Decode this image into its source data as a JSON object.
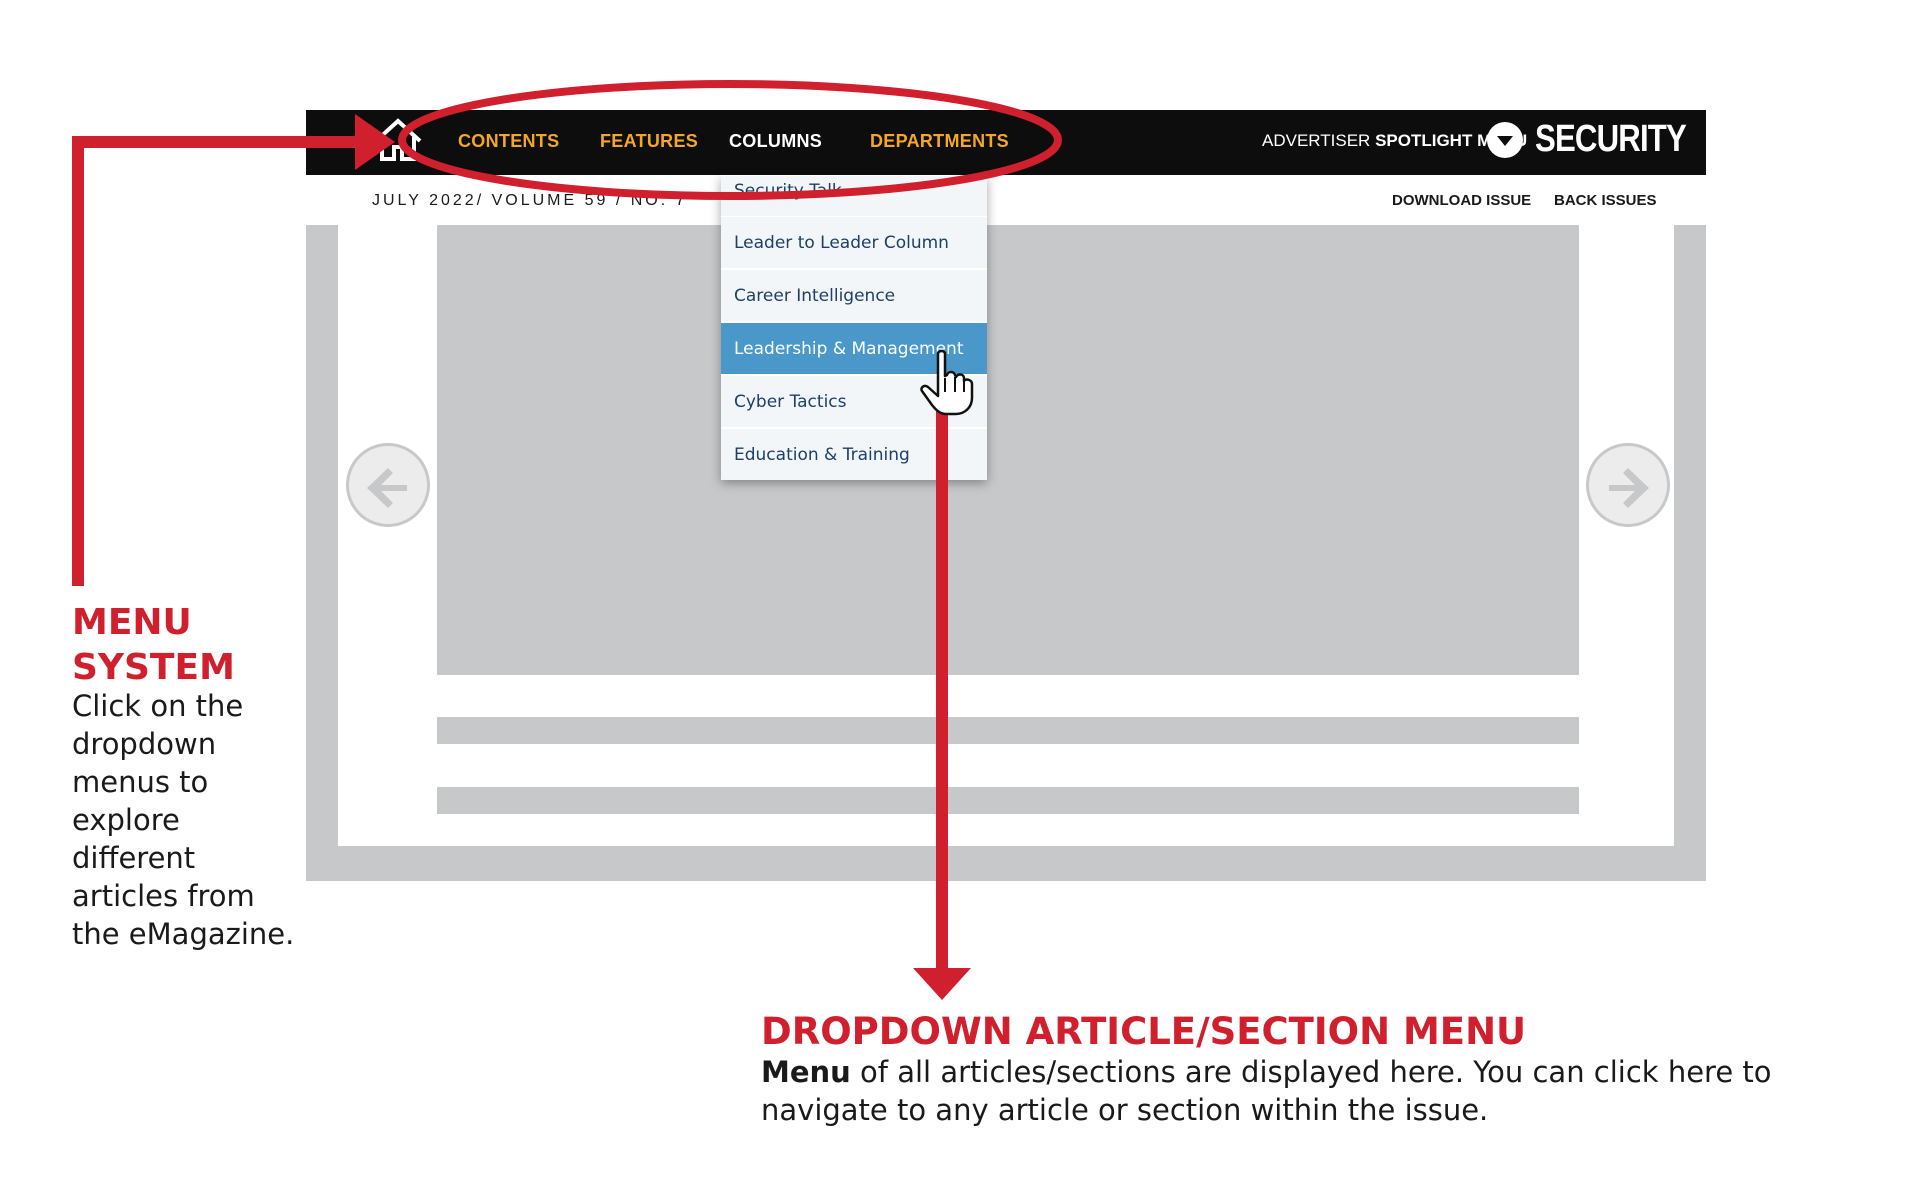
{
  "header": {
    "nav_items": [
      "CONTENTS",
      "FEATURES",
      "COLUMNS",
      "DEPARTMENTS"
    ],
    "active_nav": "COLUMNS",
    "advertiser_prefix": "ADVERTISER",
    "advertiser_bold": "SPOTLIGHT MENU",
    "brand": "SECURITY"
  },
  "subbar": {
    "issue": "JULY 2022/ VOLUME 59 / NO. 7",
    "download_label": "DOWNLOAD ISSUE",
    "back_issues_label": "BACK ISSUES"
  },
  "dropdown": {
    "items": [
      "Security Talk",
      "Leader to Leader Column",
      "Career Intelligence",
      "Leadership & Management",
      "Cyber Tactics",
      "Education & Training"
    ],
    "selected": "Leadership & Management"
  },
  "annotations": {
    "menu_system": {
      "title_line1": "MENU",
      "title_line2": "SYSTEM",
      "body": "Click on the dropdown menus to explore different articles from the eMagazine."
    },
    "dropdown_menu": {
      "title": "DROPDOWN ARTICLE/SECTION MENU",
      "body_bold": "Menu",
      "body_rest": " of all articles/sections are displayed here. You can click here to navigate to any article or section within the issue."
    }
  },
  "colors": {
    "accent_red": "#d0202d",
    "nav_orange": "#f5a623",
    "nav_black": "#0d0d0d",
    "selected_blue": "#4a97c9",
    "placeholder_gray": "#c7c8ca"
  }
}
